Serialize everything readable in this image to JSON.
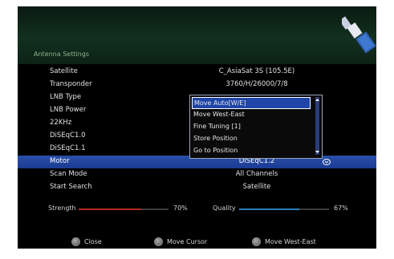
{
  "page_title": "Antenna Settings",
  "rows": [
    {
      "label": "Satellite",
      "value": "C_AsiaSat 3S (105.5E)"
    },
    {
      "label": "Transponder",
      "value": "3760/H/26000/7/8"
    },
    {
      "label": "LNB Type",
      "value": ""
    },
    {
      "label": "LNB Power",
      "value": ""
    },
    {
      "label": "22KHz",
      "value": ""
    },
    {
      "label": "DiSEqC1.0",
      "value": ""
    },
    {
      "label": "DiSEqC1.1",
      "value": ""
    },
    {
      "label": "Motor",
      "value": "DiSEqC1.2"
    },
    {
      "label": "Scan Mode",
      "value": "All Channels"
    },
    {
      "label": "Start Search",
      "value": "Satellite"
    }
  ],
  "dropdown": {
    "options": [
      "Move Auto[W/E]",
      "Move West-East",
      "Fine Tuning [1]",
      "Store Position",
      "Go to Position"
    ]
  },
  "meters": {
    "strength": {
      "label": "Strength",
      "percent_text": "70%",
      "level": 0.7,
      "color": "#b02a1a"
    },
    "quality": {
      "label": "Quality",
      "percent_text": "67%",
      "level": 0.67,
      "color": "#2a7fb8"
    }
  },
  "footer": {
    "close_label": "Close",
    "move_cursor_label": "Move Cursor",
    "move_west_east_label": "Move West-East"
  },
  "colors": {
    "selected_row": "#2a4fa8",
    "dropdown_active": "#1f45a8"
  }
}
